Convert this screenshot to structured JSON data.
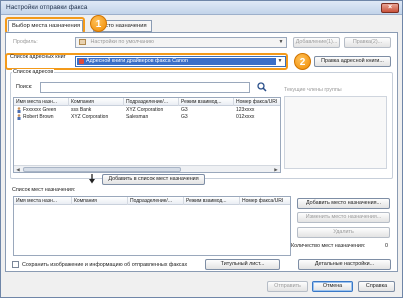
{
  "window": {
    "title": "Настройки отправки факса",
    "close_symbol": "×"
  },
  "tabs": [
    {
      "label": "Выбор места назначения"
    },
    {
      "label": "Место назначения"
    }
  ],
  "callouts": [
    "1",
    "2"
  ],
  "profile": {
    "label": "Профиль:",
    "value": "Настройки по умолчанию",
    "add_button": "Добавление(1)...",
    "edit_button": "Правка(2)..."
  },
  "address_list": {
    "label": "Список адресных книг",
    "value": "Адресной книги драйверов факса Canon",
    "edit_book_button": "Правка адресной книги..."
  },
  "address_box": {
    "title": "Список адресов",
    "search_label": "Поиск:",
    "search_value": "",
    "group_label": "Текущие члены группы",
    "columns": [
      "Имя места назн...",
      "Компания",
      "Подразделение/...",
      "Режим взаимод...",
      "Номер факса/URI"
    ],
    "rows": [
      {
        "name": "Fxxxxxx Green",
        "company": "sss Bank",
        "dept": "XYZ Corporation",
        "mode": "G3",
        "fax": "123xxxx"
      },
      {
        "name": "Robert Brown",
        "company": "XYZ Corporation",
        "dept": "Salesman",
        "mode": "G3",
        "fax": "012xxxx"
      }
    ]
  },
  "add_to_list_button": "Добавить в список мест назначения",
  "dest_list": {
    "label": "Список мест назначения:",
    "columns": [
      "Имя места назн...",
      "Компания",
      "Подразделение/...",
      "Режим взаимод...",
      "Номер факса/URI"
    ],
    "add_dest_button": "Добавить место назначения...",
    "edit_dest_button": "Изменить место назначения...",
    "delete_button": "Удалить",
    "count_label": "Количество мест назначения:",
    "count_value": "0"
  },
  "save_checkbox_label": "Сохранить изображение и информацию об отправленных факсах",
  "cover_sheet_button": "Титульный лист...",
  "details_button": "Детальные настройки...",
  "footer": {
    "send": "Отправить",
    "cancel": "Отмена",
    "help": "Справка"
  },
  "colors": {
    "highlight": "#f39a1a",
    "accent_badge": "#f08a00"
  }
}
